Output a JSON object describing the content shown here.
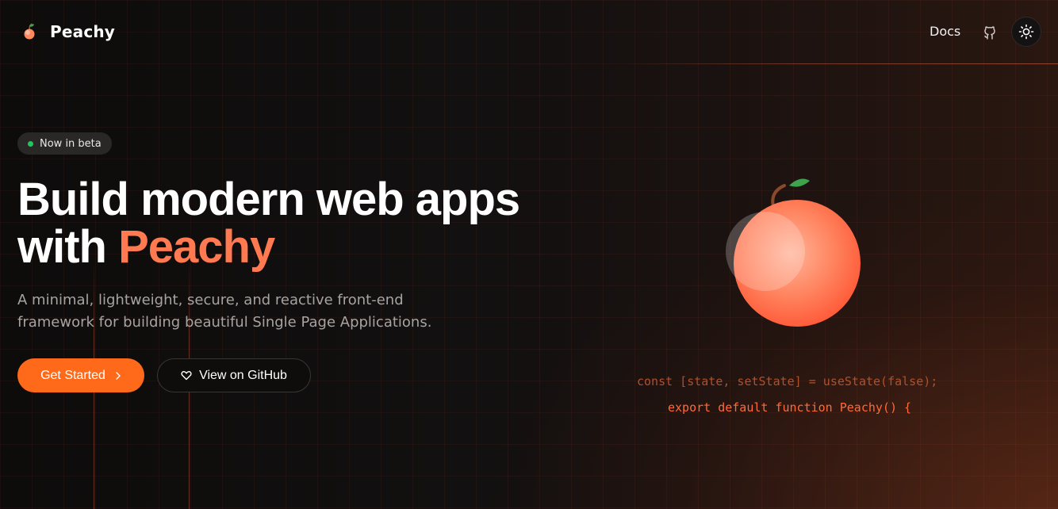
{
  "header": {
    "brand": "Peachy",
    "docs_label": "Docs",
    "github_icon": "github-icon",
    "theme_toggle_icon": "sun-icon"
  },
  "hero": {
    "badge_text": "Now in beta",
    "headline_line1": "Build modern web apps",
    "headline_prefix": "with ",
    "headline_accent": "Peachy",
    "subtitle": "A minimal, lightweight, secure, and reactive front-end framework for building beautiful Single Page Applications.",
    "primary_button": "Get Started",
    "secondary_button": "View on GitHub"
  },
  "code": {
    "line1": "const [state, setState] = useState(false);",
    "line2": "export default function Peachy() {"
  },
  "colors": {
    "accent": "#ff7a50",
    "primary_button": "#ff6a1a",
    "badge_dot": "#22c55e",
    "background": "#0f0d0c"
  }
}
